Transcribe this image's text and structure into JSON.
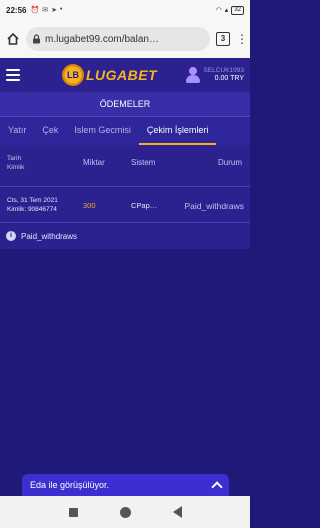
{
  "status_bar": {
    "time": "22:56",
    "notification_icons": [
      "alarm-icon",
      "message-icon",
      "telegram-icon",
      "dot-icon"
    ],
    "battery": "32"
  },
  "browser": {
    "url": "m.lugabet99.com/balan…",
    "tab_count": "3"
  },
  "header": {
    "logo_badge": "LB",
    "logo_text": "LUGABET",
    "username": "SELCUK1993",
    "balance": "0.00 TRY"
  },
  "page_title": "ÖDEMELER",
  "tabs": [
    {
      "label": "Yatır",
      "active": false
    },
    {
      "label": "Çek",
      "active": false
    },
    {
      "label": "Islem Gecmisi",
      "active": false
    },
    {
      "label": "Çekim İşlemleri",
      "active": true
    }
  ],
  "table": {
    "headers": {
      "tarih": "Tarih",
      "kimlik": "Kimlik",
      "miktar": "Miktar",
      "sistem": "Sistem",
      "durum": "Durum"
    },
    "rows": [
      {
        "date": "Cts, 31 Tem 2021",
        "id": "Kimlik: 90846774",
        "amount": "300",
        "system": "CPap…",
        "status": "Paid_withdraws"
      }
    ]
  },
  "info": {
    "text": "Paid_withdraws"
  },
  "chat": {
    "label": "Eda ile görüşülüyor."
  }
}
